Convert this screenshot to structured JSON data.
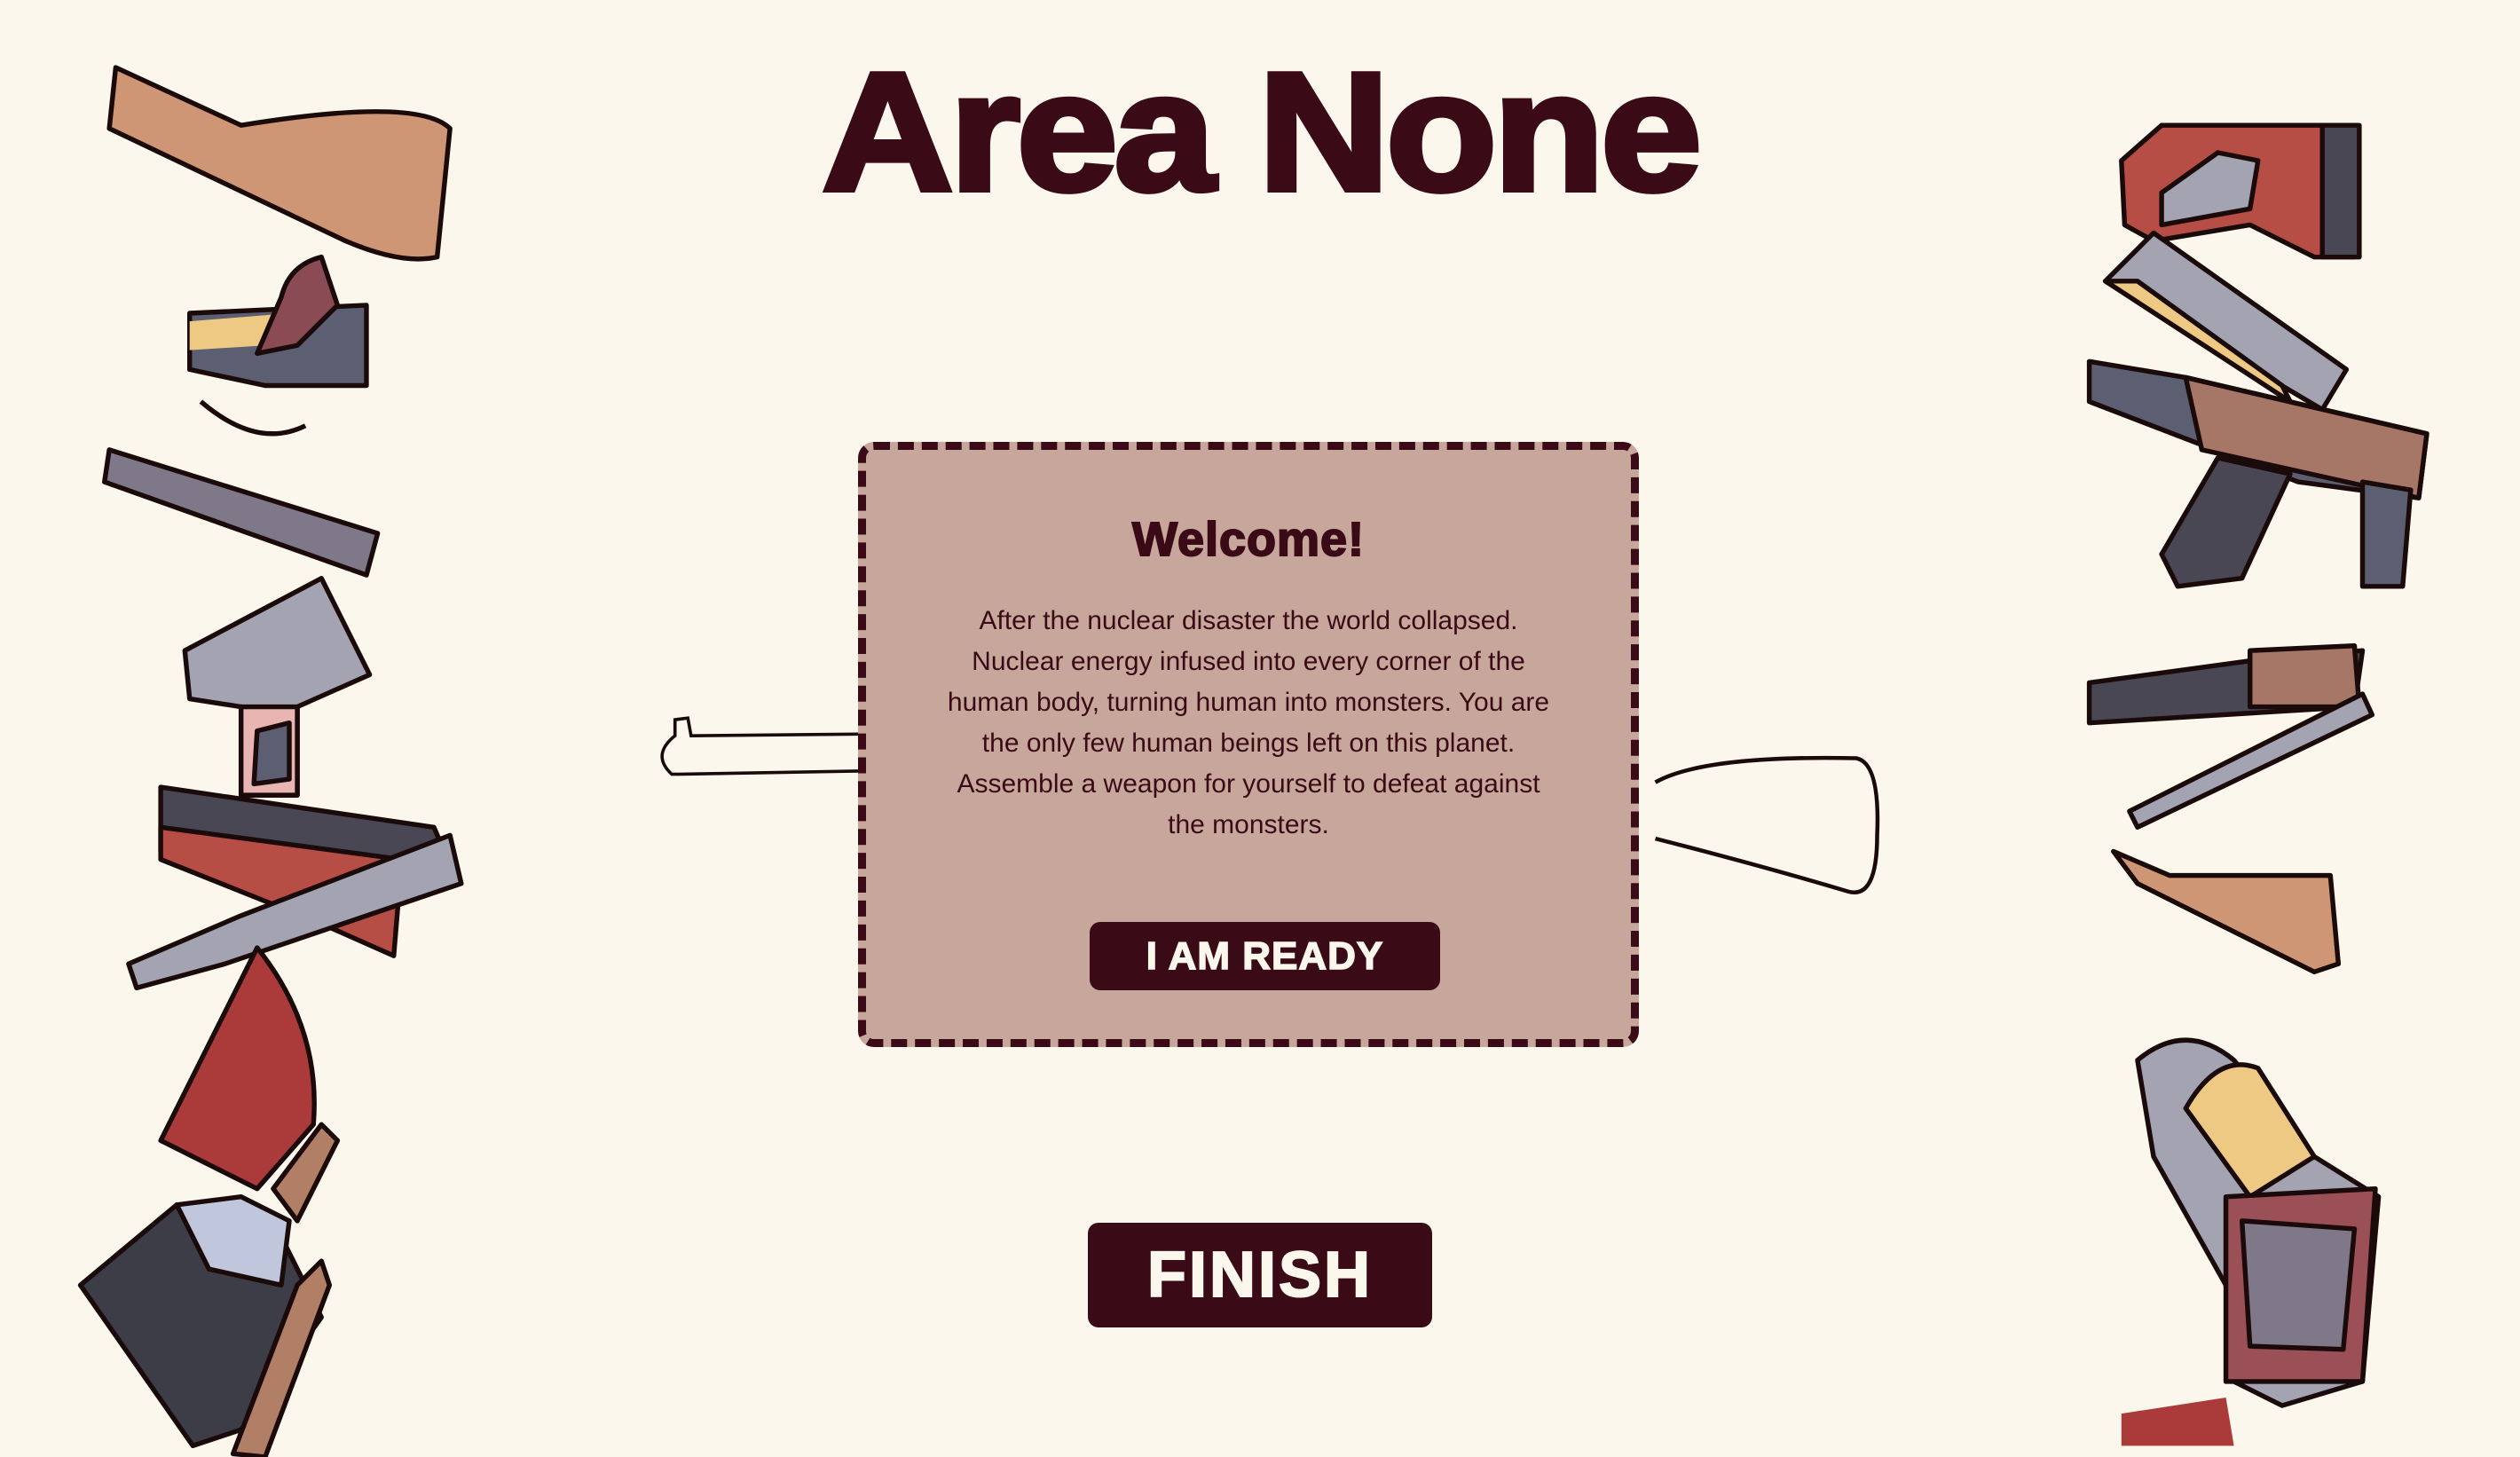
{
  "title": "Area None",
  "welcome": {
    "heading": "Welcome!",
    "body": "After the nuclear disaster the world collapsed. Nuclear energy infused into every corner of the human body, turning human into monsters. You are the only few human beings left on this planet. Assemble a weapon for yourself to defeat against the monsters.",
    "ready_button": "I AM READY"
  },
  "finish_button": "FINISH",
  "colors": {
    "background": "#fbf7ed",
    "dark": "#3a0a16",
    "card": "#c7a79b"
  }
}
